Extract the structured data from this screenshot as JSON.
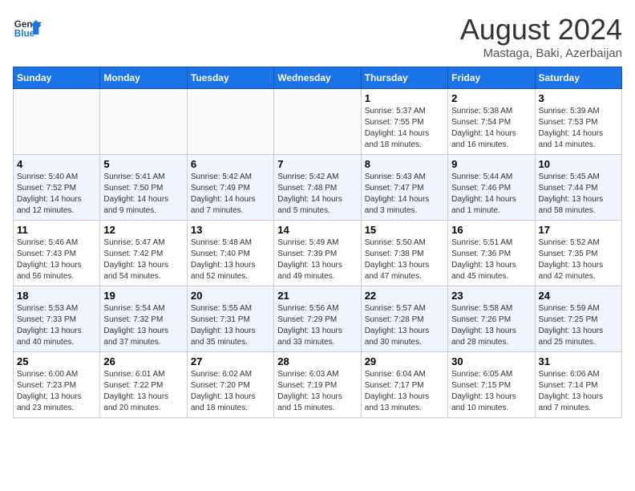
{
  "header": {
    "logo_line1": "General",
    "logo_line2": "Blue",
    "month": "August 2024",
    "location": "Mastaga, Baki, Azerbaijan"
  },
  "days_of_week": [
    "Sunday",
    "Monday",
    "Tuesday",
    "Wednesday",
    "Thursday",
    "Friday",
    "Saturday"
  ],
  "weeks": [
    [
      {
        "day": "",
        "info": ""
      },
      {
        "day": "",
        "info": ""
      },
      {
        "day": "",
        "info": ""
      },
      {
        "day": "",
        "info": ""
      },
      {
        "day": "1",
        "info": "Sunrise: 5:37 AM\nSunset: 7:55 PM\nDaylight: 14 hours\nand 18 minutes."
      },
      {
        "day": "2",
        "info": "Sunrise: 5:38 AM\nSunset: 7:54 PM\nDaylight: 14 hours\nand 16 minutes."
      },
      {
        "day": "3",
        "info": "Sunrise: 5:39 AM\nSunset: 7:53 PM\nDaylight: 14 hours\nand 14 minutes."
      }
    ],
    [
      {
        "day": "4",
        "info": "Sunrise: 5:40 AM\nSunset: 7:52 PM\nDaylight: 14 hours\nand 12 minutes."
      },
      {
        "day": "5",
        "info": "Sunrise: 5:41 AM\nSunset: 7:50 PM\nDaylight: 14 hours\nand 9 minutes."
      },
      {
        "day": "6",
        "info": "Sunrise: 5:42 AM\nSunset: 7:49 PM\nDaylight: 14 hours\nand 7 minutes."
      },
      {
        "day": "7",
        "info": "Sunrise: 5:42 AM\nSunset: 7:48 PM\nDaylight: 14 hours\nand 5 minutes."
      },
      {
        "day": "8",
        "info": "Sunrise: 5:43 AM\nSunset: 7:47 PM\nDaylight: 14 hours\nand 3 minutes."
      },
      {
        "day": "9",
        "info": "Sunrise: 5:44 AM\nSunset: 7:46 PM\nDaylight: 14 hours\nand 1 minute."
      },
      {
        "day": "10",
        "info": "Sunrise: 5:45 AM\nSunset: 7:44 PM\nDaylight: 13 hours\nand 58 minutes."
      }
    ],
    [
      {
        "day": "11",
        "info": "Sunrise: 5:46 AM\nSunset: 7:43 PM\nDaylight: 13 hours\nand 56 minutes."
      },
      {
        "day": "12",
        "info": "Sunrise: 5:47 AM\nSunset: 7:42 PM\nDaylight: 13 hours\nand 54 minutes."
      },
      {
        "day": "13",
        "info": "Sunrise: 5:48 AM\nSunset: 7:40 PM\nDaylight: 13 hours\nand 52 minutes."
      },
      {
        "day": "14",
        "info": "Sunrise: 5:49 AM\nSunset: 7:39 PM\nDaylight: 13 hours\nand 49 minutes."
      },
      {
        "day": "15",
        "info": "Sunrise: 5:50 AM\nSunset: 7:38 PM\nDaylight: 13 hours\nand 47 minutes."
      },
      {
        "day": "16",
        "info": "Sunrise: 5:51 AM\nSunset: 7:36 PM\nDaylight: 13 hours\nand 45 minutes."
      },
      {
        "day": "17",
        "info": "Sunrise: 5:52 AM\nSunset: 7:35 PM\nDaylight: 13 hours\nand 42 minutes."
      }
    ],
    [
      {
        "day": "18",
        "info": "Sunrise: 5:53 AM\nSunset: 7:33 PM\nDaylight: 13 hours\nand 40 minutes."
      },
      {
        "day": "19",
        "info": "Sunrise: 5:54 AM\nSunset: 7:32 PM\nDaylight: 13 hours\nand 37 minutes."
      },
      {
        "day": "20",
        "info": "Sunrise: 5:55 AM\nSunset: 7:31 PM\nDaylight: 13 hours\nand 35 minutes."
      },
      {
        "day": "21",
        "info": "Sunrise: 5:56 AM\nSunset: 7:29 PM\nDaylight: 13 hours\nand 33 minutes."
      },
      {
        "day": "22",
        "info": "Sunrise: 5:57 AM\nSunset: 7:28 PM\nDaylight: 13 hours\nand 30 minutes."
      },
      {
        "day": "23",
        "info": "Sunrise: 5:58 AM\nSunset: 7:26 PM\nDaylight: 13 hours\nand 28 minutes."
      },
      {
        "day": "24",
        "info": "Sunrise: 5:59 AM\nSunset: 7:25 PM\nDaylight: 13 hours\nand 25 minutes."
      }
    ],
    [
      {
        "day": "25",
        "info": "Sunrise: 6:00 AM\nSunset: 7:23 PM\nDaylight: 13 hours\nand 23 minutes."
      },
      {
        "day": "26",
        "info": "Sunrise: 6:01 AM\nSunset: 7:22 PM\nDaylight: 13 hours\nand 20 minutes."
      },
      {
        "day": "27",
        "info": "Sunrise: 6:02 AM\nSunset: 7:20 PM\nDaylight: 13 hours\nand 18 minutes."
      },
      {
        "day": "28",
        "info": "Sunrise: 6:03 AM\nSunset: 7:19 PM\nDaylight: 13 hours\nand 15 minutes."
      },
      {
        "day": "29",
        "info": "Sunrise: 6:04 AM\nSunset: 7:17 PM\nDaylight: 13 hours\nand 13 minutes."
      },
      {
        "day": "30",
        "info": "Sunrise: 6:05 AM\nSunset: 7:15 PM\nDaylight: 13 hours\nand 10 minutes."
      },
      {
        "day": "31",
        "info": "Sunrise: 6:06 AM\nSunset: 7:14 PM\nDaylight: 13 hours\nand 7 minutes."
      }
    ]
  ]
}
